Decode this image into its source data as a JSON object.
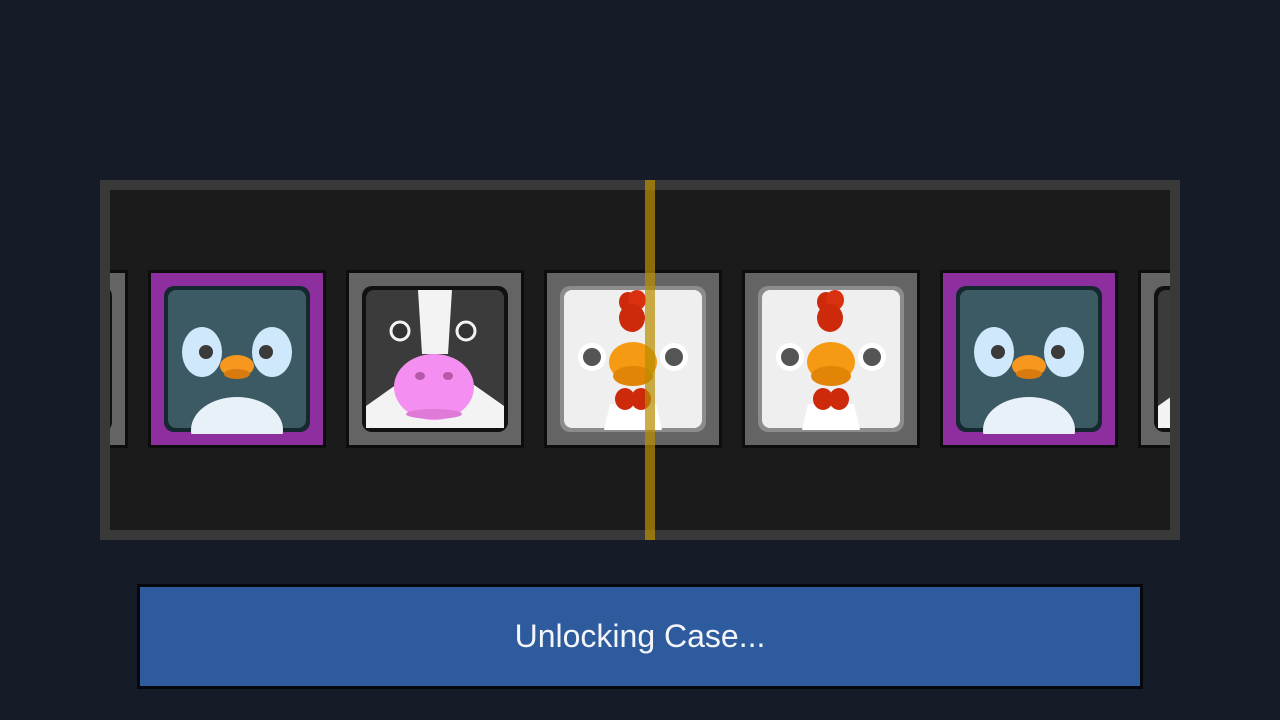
{
  "colors": {
    "background": "#151b27",
    "window_border": "#393939",
    "window_fill": "#1b1b1b",
    "rarity_common": "#646464",
    "rarity_rare": "#8e2fa0",
    "marker": "#b88e00",
    "button": "#2d5b9d"
  },
  "reel": {
    "items": [
      {
        "animal": "cow",
        "rarity": "common",
        "icon": "cow-icon"
      },
      {
        "animal": "penguin",
        "rarity": "rare",
        "icon": "penguin-icon"
      },
      {
        "animal": "cow",
        "rarity": "common",
        "icon": "cow-icon"
      },
      {
        "animal": "chicken",
        "rarity": "common",
        "icon": "chicken-icon"
      },
      {
        "animal": "chicken",
        "rarity": "common",
        "icon": "chicken-icon"
      },
      {
        "animal": "penguin",
        "rarity": "rare",
        "icon": "penguin-icon"
      },
      {
        "animal": "cow",
        "rarity": "common",
        "icon": "cow-icon"
      }
    ]
  },
  "status": {
    "label": "Unlocking Case..."
  }
}
